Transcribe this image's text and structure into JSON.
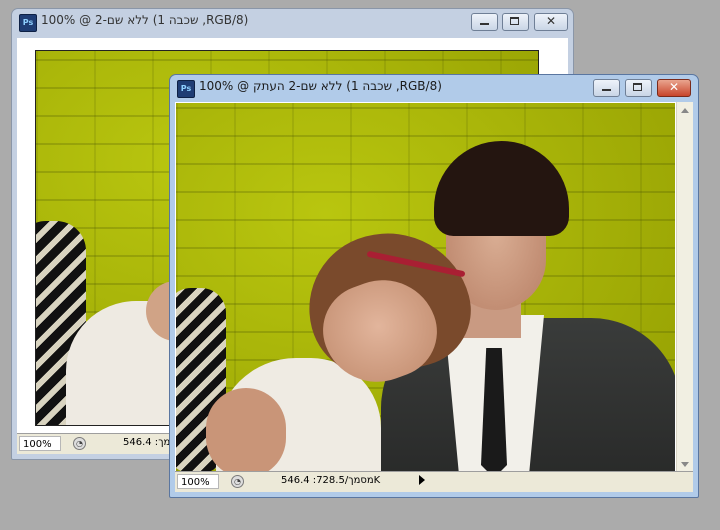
{
  "back_window": {
    "app_icon": "photoshop-icon",
    "title": "ללא שם-2 @ 100% (שכבה 1 ,RGB/8)",
    "zoom": "100%",
    "status": "546.4 :מסמך",
    "buttons": [
      "minimize-icon",
      "maximize-icon",
      "close-icon"
    ]
  },
  "front_window": {
    "app_icon": "photoshop-icon",
    "title": "ללא שם-2 העתק @ 100% (שכבה 1 ,RGB/8)",
    "zoom": "100%",
    "status": "546.4 :מסמך/728.5K",
    "buttons": [
      "minimize-icon",
      "maximize-icon",
      "close-icon"
    ]
  },
  "labels": {
    "ps": "Ps",
    "close_glyph": "✕"
  },
  "colors": {
    "wall": "#a7b405",
    "titlebar_active": "#b1cbe9",
    "titlebar_inactive": "#c4d0e2"
  }
}
